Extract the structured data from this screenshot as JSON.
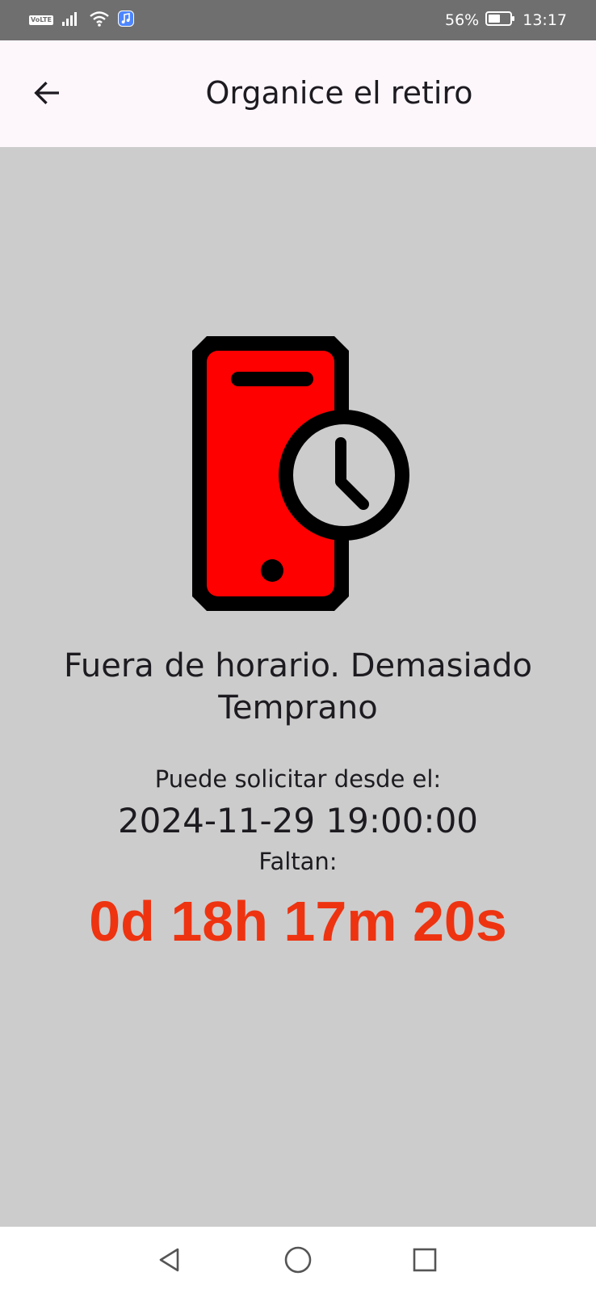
{
  "status_bar": {
    "volte": "VoLTE",
    "battery_percent": "56%",
    "time": "13:17",
    "battery_level": 0.56,
    "icons": [
      "volte-icon",
      "signal-icon",
      "wifi-icon",
      "music-app-icon",
      "battery-icon"
    ]
  },
  "app_bar": {
    "title": "Organice el retiro",
    "back_icon": "arrow-back-icon"
  },
  "main": {
    "illustration": "phone-clock-icon",
    "status_title": "Fuera de horario. Demasiado Temprano",
    "available_from_label": "Puede solicitar desde el:",
    "available_from_value": "2024-11-29 19:00:00",
    "remaining_label": "Faltan:",
    "countdown": "0d 18h 17m 20s"
  },
  "nav_bar": {
    "icons": [
      "nav-back-icon",
      "nav-home-icon",
      "nav-recents-icon"
    ]
  },
  "colors": {
    "status_bar_bg": "#6f6f6f",
    "app_bar_bg": "#fdf7fc",
    "content_bg": "#cccccc",
    "phone_fill": "#ff0000",
    "countdown": "#ee3311",
    "text": "#1d1b20"
  }
}
